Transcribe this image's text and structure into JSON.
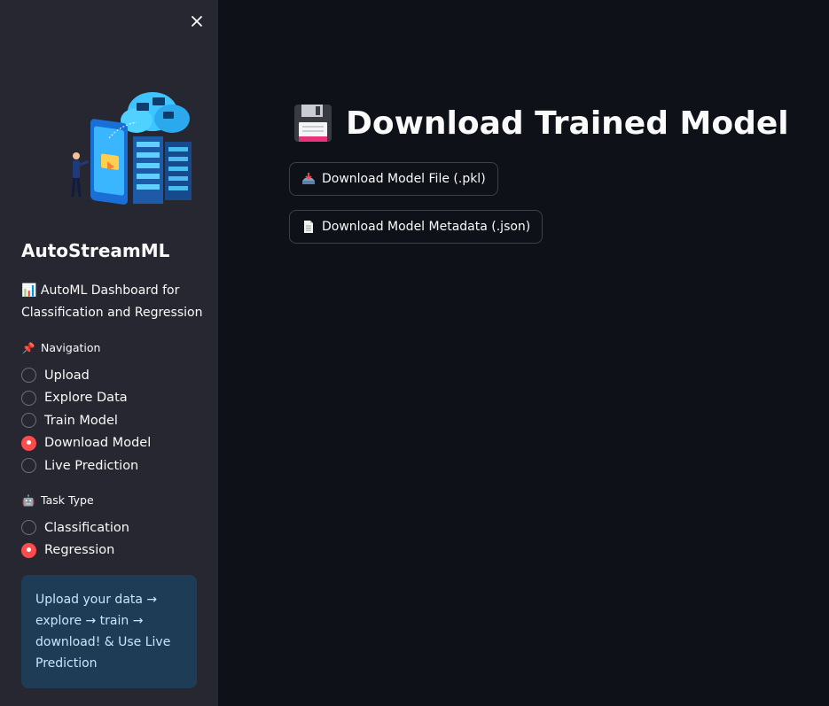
{
  "sidebar": {
    "close_icon": "close-icon",
    "illustration_icon": "cloud-server-illustration",
    "app_name": "AutoStreamML",
    "description": "📊 AutoML Dashboard for Classification and Regression",
    "navigation": {
      "label": "Navigation",
      "icon": "📌",
      "selected": "Download Model",
      "options": [
        "Upload",
        "Explore Data",
        "Train Model",
        "Download Model",
        "Live Prediction"
      ]
    },
    "task_type": {
      "label": "Task Type",
      "icon": "🤖",
      "selected": "Regression",
      "options": [
        "Classification",
        "Regression"
      ]
    },
    "info": "Upload your data → explore → train → download! & Use Live Prediction"
  },
  "main": {
    "title": "Download Trained Model",
    "title_icon": "floppy-disk-icon",
    "buttons": {
      "pkl": {
        "label": "Download Model File (.pkl)",
        "icon": "inbox-tray-icon"
      },
      "json": {
        "label": "Download Model Metadata (.json)",
        "icon": "page-icon"
      }
    }
  },
  "colors": {
    "background": "#0e1117",
    "sidebar": "#262730",
    "accent": "#ff4b4b",
    "info_bg": "#1f3c57",
    "info_text": "#c7e6fa"
  }
}
